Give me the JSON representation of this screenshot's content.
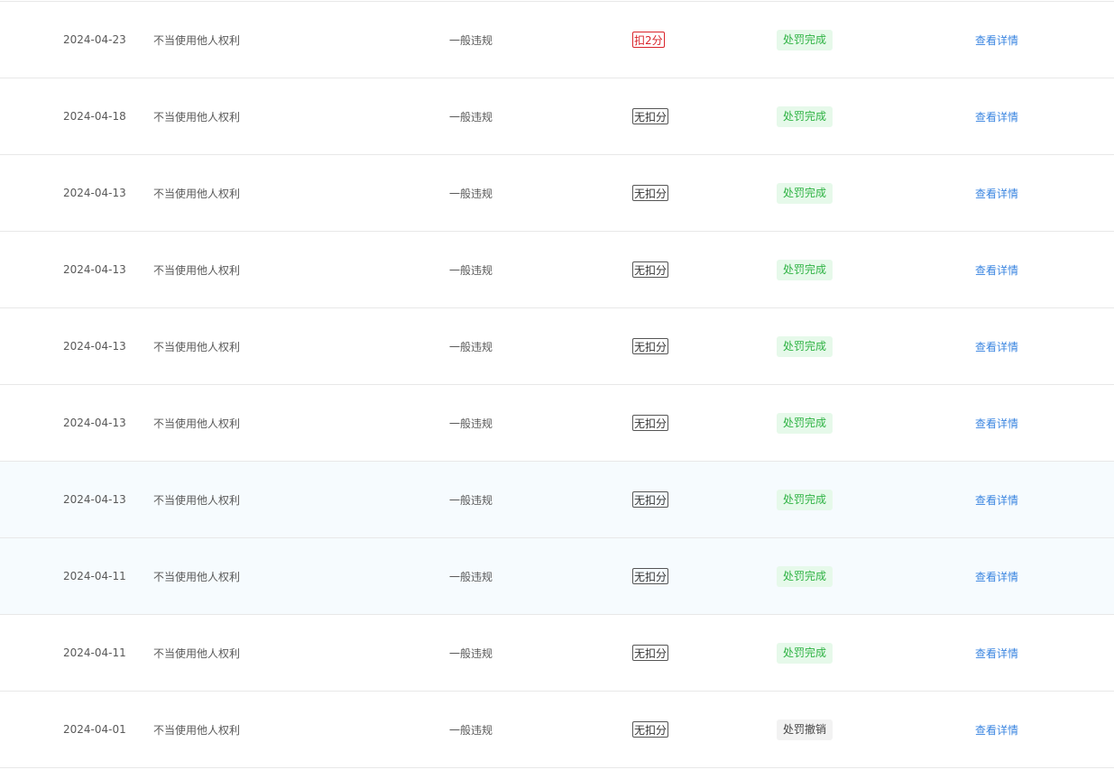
{
  "records": [
    {
      "date": "2024-04-23",
      "reason": "不当使用他人权利",
      "type": "一般违规",
      "points": "扣2分",
      "points_style": "deduct",
      "status": "处罚完成",
      "status_style": "done",
      "action": "查看详情",
      "highlighted": false
    },
    {
      "date": "2024-04-18",
      "reason": "不当使用他人权利",
      "type": "一般违规",
      "points": "无扣分",
      "points_style": "none",
      "status": "处罚完成",
      "status_style": "done",
      "action": "查看详情",
      "highlighted": false
    },
    {
      "date": "2024-04-13",
      "reason": "不当使用他人权利",
      "type": "一般违规",
      "points": "无扣分",
      "points_style": "none",
      "status": "处罚完成",
      "status_style": "done",
      "action": "查看详情",
      "highlighted": false
    },
    {
      "date": "2024-04-13",
      "reason": "不当使用他人权利",
      "type": "一般违规",
      "points": "无扣分",
      "points_style": "none",
      "status": "处罚完成",
      "status_style": "done",
      "action": "查看详情",
      "highlighted": false
    },
    {
      "date": "2024-04-13",
      "reason": "不当使用他人权利",
      "type": "一般违规",
      "points": "无扣分",
      "points_style": "none",
      "status": "处罚完成",
      "status_style": "done",
      "action": "查看详情",
      "highlighted": false
    },
    {
      "date": "2024-04-13",
      "reason": "不当使用他人权利",
      "type": "一般违规",
      "points": "无扣分",
      "points_style": "none",
      "status": "处罚完成",
      "status_style": "done",
      "action": "查看详情",
      "highlighted": false
    },
    {
      "date": "2024-04-13",
      "reason": "不当使用他人权利",
      "type": "一般违规",
      "points": "无扣分",
      "points_style": "none",
      "status": "处罚完成",
      "status_style": "done",
      "action": "查看详情",
      "highlighted": true
    },
    {
      "date": "2024-04-11",
      "reason": "不当使用他人权利",
      "type": "一般违规",
      "points": "无扣分",
      "points_style": "none",
      "status": "处罚完成",
      "status_style": "done",
      "action": "查看详情",
      "highlighted": true
    },
    {
      "date": "2024-04-11",
      "reason": "不当使用他人权利",
      "type": "一般违规",
      "points": "无扣分",
      "points_style": "none",
      "status": "处罚完成",
      "status_style": "done",
      "action": "查看详情",
      "highlighted": false
    },
    {
      "date": "2024-04-01",
      "reason": "不当使用他人权利",
      "type": "一般违规",
      "points": "无扣分",
      "points_style": "none",
      "status": "处罚撤销",
      "status_style": "revoked",
      "action": "查看详情",
      "highlighted": false
    }
  ],
  "colors": {
    "deduct_red": "#d9232a",
    "done_green": "#2fb344",
    "done_bg": "#e6f9ea",
    "link_blue": "#3a85e0",
    "highlight_row_bg": "#f6fbfe"
  }
}
